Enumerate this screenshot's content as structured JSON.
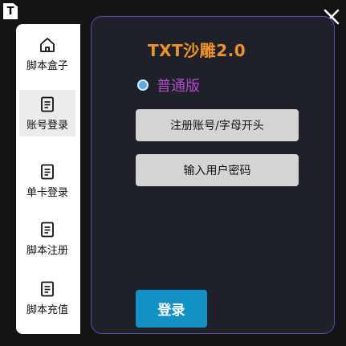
{
  "window": {
    "app_icon_letter": "T"
  },
  "sidebar": {
    "items": [
      {
        "label": "脚本盒子",
        "icon": "home-icon"
      },
      {
        "label": "账号登录",
        "icon": "document-icon",
        "active": true
      },
      {
        "label": "单卡登录",
        "icon": "document-icon"
      },
      {
        "label": "脚本注册",
        "icon": "document-icon"
      },
      {
        "label": "脚本充值",
        "icon": "document-icon"
      }
    ]
  },
  "panel": {
    "title": "TXT沙雕2.0",
    "radio_label": "普通版",
    "register_button": "注册账号/字母开头",
    "password_button": "输入用户密码",
    "login_button": "登录"
  },
  "colors": {
    "accent_orange": "#f0922b",
    "radio_text": "#b24ecb",
    "login_blue": "#1291c7",
    "panel_border": "#5a4fb0"
  }
}
